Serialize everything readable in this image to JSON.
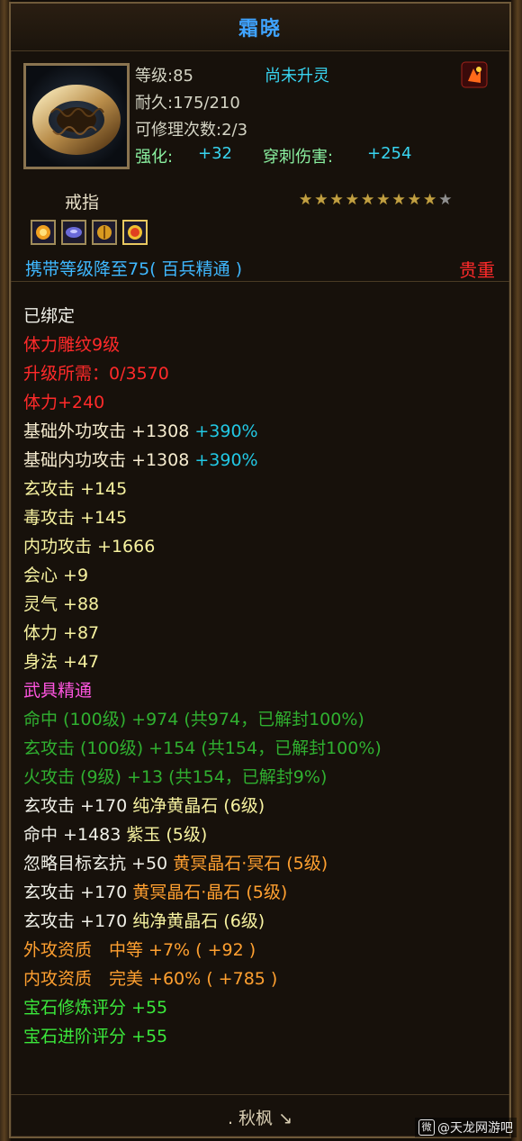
{
  "title": "霜晓",
  "stats": {
    "level": "等级:85",
    "spirit_status": "尚未升灵",
    "durability": "耐久:175/210",
    "repair": "可修理次数:2/3",
    "enhance_label": "强化:",
    "enhance_value": "+32",
    "pierce_label": "穿刺伤害:",
    "pierce_value": "+254"
  },
  "item_type": "戒指",
  "stars": {
    "filled": 9,
    "total": 10
  },
  "carry_level": "携带等级降至75( 百兵精通 )",
  "rarity": "贵重",
  "attributes": [
    {
      "name": "bound-status",
      "parts": [
        {
          "text": "已绑定",
          "color": "white"
        }
      ]
    },
    {
      "name": "carving-level",
      "parts": [
        {
          "text": "体力雕纹9级",
          "color": "red"
        }
      ]
    },
    {
      "name": "upgrade-required",
      "parts": [
        {
          "text": "升级所需：0/3570",
          "color": "red"
        }
      ]
    },
    {
      "name": "carving-stamina",
      "parts": [
        {
          "text": "体力+240",
          "color": "red"
        }
      ]
    },
    {
      "name": "base-outer-attack",
      "parts": [
        {
          "text": "基础外功攻击 +1308 ",
          "color": "beige"
        },
        {
          "text": "+390%",
          "color": "teal"
        }
      ]
    },
    {
      "name": "base-inner-attack",
      "parts": [
        {
          "text": "基础内功攻击 +1308 ",
          "color": "beige"
        },
        {
          "text": "+390%",
          "color": "teal"
        }
      ]
    },
    {
      "name": "mystic-attack",
      "parts": [
        {
          "text": "玄攻击 +145",
          "color": "yellow"
        }
      ]
    },
    {
      "name": "poison-attack",
      "parts": [
        {
          "text": "毒攻击 +145",
          "color": "yellow"
        }
      ]
    },
    {
      "name": "inner-attack",
      "parts": [
        {
          "text": "内功攻击 +1666",
          "color": "yellow"
        }
      ]
    },
    {
      "name": "critical",
      "parts": [
        {
          "text": "会心 +9",
          "color": "yellow"
        }
      ]
    },
    {
      "name": "spirit",
      "parts": [
        {
          "text": "灵气 +88",
          "color": "yellow"
        }
      ]
    },
    {
      "name": "stamina",
      "parts": [
        {
          "text": "体力 +87",
          "color": "yellow"
        }
      ]
    },
    {
      "name": "agility",
      "parts": [
        {
          "text": "身法 +47",
          "color": "yellow"
        }
      ]
    },
    {
      "name": "weapon-mastery",
      "parts": [
        {
          "text": "武具精通",
          "color": "pink"
        }
      ]
    },
    {
      "name": "mastery-hit",
      "parts": [
        {
          "text": "命中 (100级) +974 (共974，已解封100%)",
          "color": "dgreen"
        }
      ]
    },
    {
      "name": "mastery-mystic",
      "parts": [
        {
          "text": "玄攻击 (100级) +154 (共154，已解封100%)",
          "color": "dgreen"
        }
      ]
    },
    {
      "name": "mastery-fire",
      "parts": [
        {
          "text": "火攻击 (9级) +13 (共154，已解封9%)",
          "color": "dgreen"
        }
      ]
    },
    {
      "name": "gem-1",
      "parts": [
        {
          "text": "玄攻击 +170 ",
          "color": "white"
        },
        {
          "text": "纯净黄晶石 (6级)",
          "color": "yellow"
        }
      ]
    },
    {
      "name": "gem-2",
      "parts": [
        {
          "text": "命中 +1483 ",
          "color": "white"
        },
        {
          "text": "紫玉 (5级)",
          "color": "yellow"
        }
      ]
    },
    {
      "name": "gem-3",
      "parts": [
        {
          "text": "忽略目标玄抗 +50 ",
          "color": "white"
        },
        {
          "text": "黄冥晶石·冥石 (5级)",
          "color": "orange"
        }
      ]
    },
    {
      "name": "gem-4",
      "parts": [
        {
          "text": "玄攻击 +170 ",
          "color": "white"
        },
        {
          "text": "黄冥晶石·晶石 (5级)",
          "color": "orange"
        }
      ]
    },
    {
      "name": "gem-5",
      "parts": [
        {
          "text": "玄攻击 +170 ",
          "color": "white"
        },
        {
          "text": "纯净黄晶石 (6级)",
          "color": "yellow"
        }
      ]
    },
    {
      "name": "outer-quality",
      "parts": [
        {
          "text": "外攻资质　中等 +7% ( +92 )",
          "color": "orange"
        }
      ]
    },
    {
      "name": "inner-quality",
      "parts": [
        {
          "text": "内攻资质　完美 +60% ( +785 )",
          "color": "orange"
        }
      ]
    },
    {
      "name": "gem-refine-score",
      "parts": [
        {
          "text": "宝石修炼评分 +55",
          "color": "green"
        }
      ]
    },
    {
      "name": "gem-advance-score",
      "parts": [
        {
          "text": "宝石进阶评分 +55",
          "color": "green"
        }
      ]
    }
  ],
  "signature": ". 秋枫 ↘",
  "watermark": "@天龙网游吧",
  "colors": {
    "white": "#f0f0e8",
    "red": "#ff2a2a",
    "beige": "#f6ecd0",
    "teal": "#22c8e4",
    "yellow": "#f7f2a0",
    "pink": "#ff55e0",
    "dgreen": "#30b030",
    "orange": "#ffa030",
    "green": "#3be83b"
  }
}
